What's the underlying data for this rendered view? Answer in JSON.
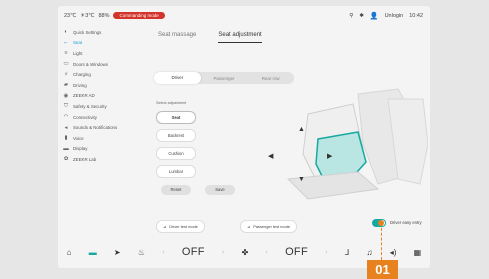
{
  "status_bar": {
    "temp": "23℃",
    "weather": "☀3℃",
    "battery": "88%",
    "alert": "Commanding mode",
    "user_label": "Unlogin",
    "time": "10:42"
  },
  "sidebar": {
    "items": [
      {
        "label": "Quick Settings",
        "icon": "quick-settings-icon"
      },
      {
        "label": "Seat",
        "icon": "seat-icon",
        "active": true
      },
      {
        "label": "Light",
        "icon": "light-icon"
      },
      {
        "label": "Doors & Windows",
        "icon": "door-icon"
      },
      {
        "label": "Charging",
        "icon": "charging-icon"
      },
      {
        "label": "Driving",
        "icon": "driving-icon"
      },
      {
        "label": "ZEEKR AD",
        "icon": "ad-icon"
      },
      {
        "label": "Safety & Security",
        "icon": "shield-icon"
      },
      {
        "label": "Connectivity",
        "icon": "wifi-icon"
      },
      {
        "label": "Sounds & Notifications",
        "icon": "sound-icon"
      },
      {
        "label": "Voice",
        "icon": "voice-icon"
      },
      {
        "label": "Display",
        "icon": "display-icon"
      },
      {
        "label": "ZEEKR Lab",
        "icon": "lab-icon"
      }
    ]
  },
  "tabs": [
    {
      "label": "Seat massage"
    },
    {
      "label": "Seat adjustment",
      "active": true
    }
  ],
  "seat_select": [
    "Driver",
    "Passenger",
    "Rear row"
  ],
  "select_adjustment_label": "Select adjustment",
  "adjust_buttons": [
    "Seat",
    "Backrest",
    "Cushion",
    "Lumbar"
  ],
  "reset_label": "Reset",
  "save_label": "Save",
  "driver_test_label": "Driver test mode",
  "passenger_test_label": "Passenger test mode",
  "easy_entry_label": "Driver easy entry",
  "easy_entry_on": true,
  "dock": {
    "ac_left": "OFF",
    "ac_right": "OFF"
  },
  "callout": "01",
  "colors": {
    "accent": "#16a9a1",
    "callout": "#e8821e",
    "alert": "#d3342b"
  }
}
